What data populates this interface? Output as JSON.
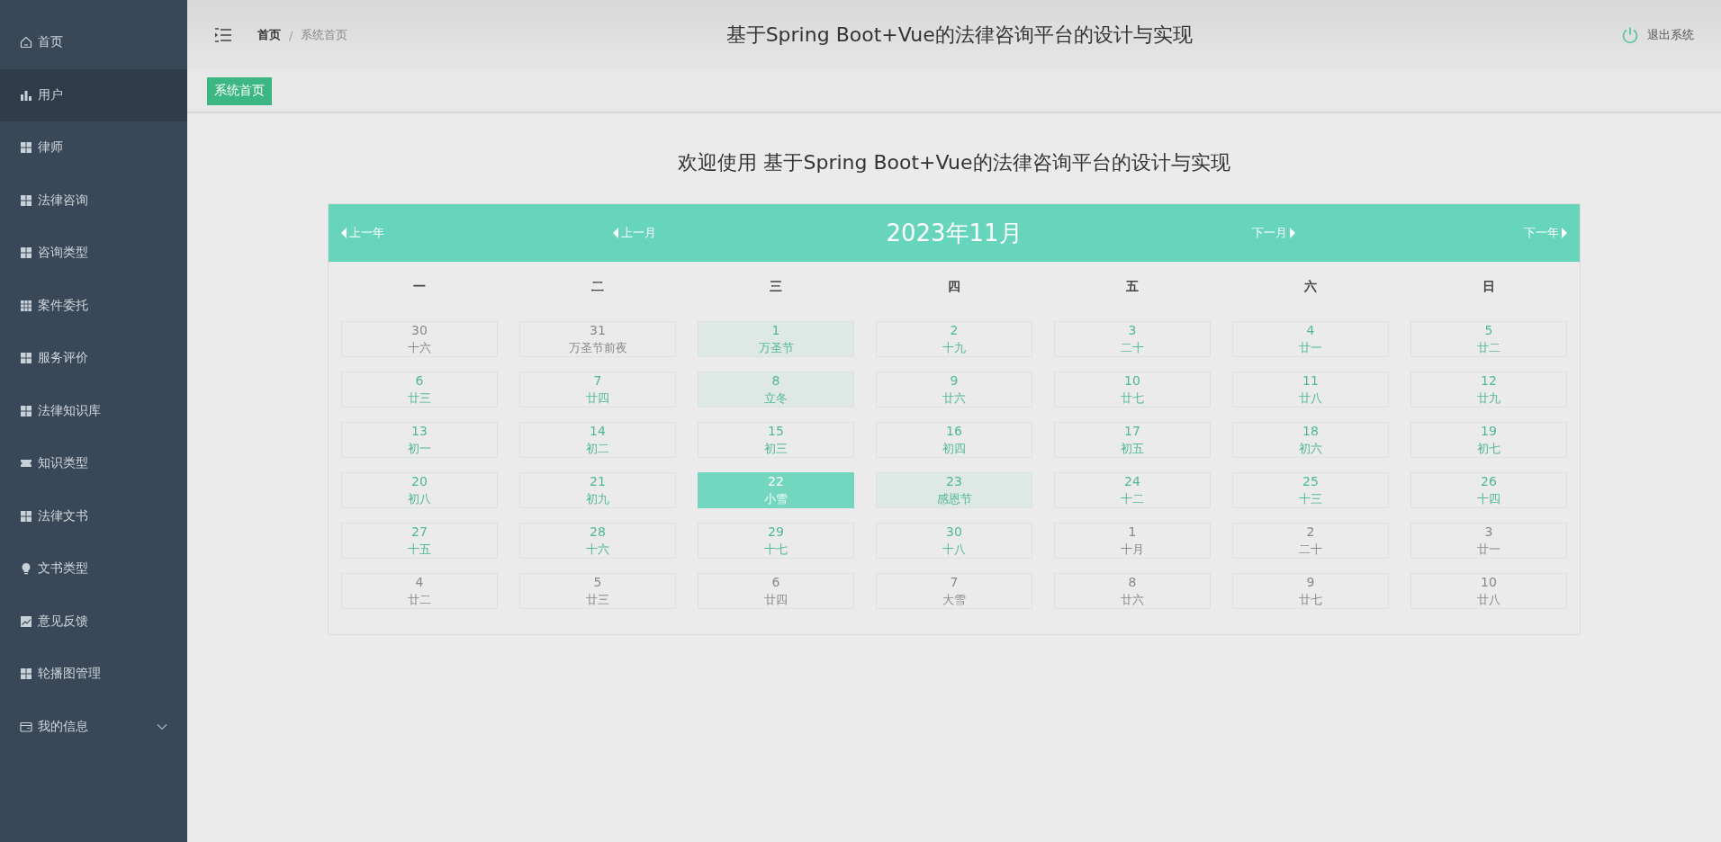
{
  "sidebar": {
    "items": [
      {
        "label": "首页",
        "selected": false
      },
      {
        "label": "用户",
        "selected": true
      },
      {
        "label": "律师",
        "selected": false
      },
      {
        "label": "法律咨询",
        "selected": false
      },
      {
        "label": "咨询类型",
        "selected": false
      },
      {
        "label": "案件委托",
        "selected": false
      },
      {
        "label": "服务评价",
        "selected": false
      },
      {
        "label": "法律知识库",
        "selected": false
      },
      {
        "label": "知识类型",
        "selected": false
      },
      {
        "label": "法律文书",
        "selected": false
      },
      {
        "label": "文书类型",
        "selected": false
      },
      {
        "label": "意见反馈",
        "selected": false
      },
      {
        "label": "轮播图管理",
        "selected": false
      },
      {
        "label": "我的信息",
        "selected": false,
        "expanded": false
      }
    ]
  },
  "header": {
    "breadcrumb": [
      "首页",
      "系统首页"
    ],
    "breadcrumb_separator": "/",
    "title": "基于Spring Boot+Vue的法律咨询平台的设计与实现",
    "logout": "退出系统"
  },
  "tags": [
    {
      "label": "系统首页",
      "selected": true
    }
  ],
  "welcome": "欢迎使用 基于Spring Boot+Vue的法律咨询平台的设计与实现",
  "calendar": {
    "prev_year": "上一年",
    "prev_month": "上一月",
    "month": "2023年11月",
    "next_month": "下一月",
    "next_year": "下一年",
    "weekdays": [
      "一",
      "二",
      "三",
      "四",
      "五",
      "六",
      "日"
    ],
    "days": [
      {
        "day": "30",
        "lunar": "十六",
        "kind": "other"
      },
      {
        "day": "31",
        "lunar": "万圣节前夜",
        "kind": "other"
      },
      {
        "day": "1",
        "lunar": "万圣节",
        "kind": "festival"
      },
      {
        "day": "2",
        "lunar": "十九",
        "kind": "day"
      },
      {
        "day": "3",
        "lunar": "二十",
        "kind": "day"
      },
      {
        "day": "4",
        "lunar": "廿一",
        "kind": "day"
      },
      {
        "day": "5",
        "lunar": "廿二",
        "kind": "day"
      },
      {
        "day": "6",
        "lunar": "廿三",
        "kind": "day"
      },
      {
        "day": "7",
        "lunar": "廿四",
        "kind": "day"
      },
      {
        "day": "8",
        "lunar": "立冬",
        "kind": "festival"
      },
      {
        "day": "9",
        "lunar": "廿六",
        "kind": "day"
      },
      {
        "day": "10",
        "lunar": "廿七",
        "kind": "day"
      },
      {
        "day": "11",
        "lunar": "廿八",
        "kind": "day"
      },
      {
        "day": "12",
        "lunar": "廿九",
        "kind": "day"
      },
      {
        "day": "13",
        "lunar": "初一",
        "kind": "day"
      },
      {
        "day": "14",
        "lunar": "初二",
        "kind": "day"
      },
      {
        "day": "15",
        "lunar": "初三",
        "kind": "day"
      },
      {
        "day": "16",
        "lunar": "初四",
        "kind": "day"
      },
      {
        "day": "17",
        "lunar": "初五",
        "kind": "day"
      },
      {
        "day": "18",
        "lunar": "初六",
        "kind": "day"
      },
      {
        "day": "19",
        "lunar": "初七",
        "kind": "day"
      },
      {
        "day": "20",
        "lunar": "初八",
        "kind": "day"
      },
      {
        "day": "21",
        "lunar": "初九",
        "kind": "day"
      },
      {
        "day": "22",
        "lunar": "小雪",
        "kind": "today"
      },
      {
        "day": "23",
        "lunar": "感恩节",
        "kind": "festival"
      },
      {
        "day": "24",
        "lunar": "十二",
        "kind": "day"
      },
      {
        "day": "25",
        "lunar": "十三",
        "kind": "day"
      },
      {
        "day": "26",
        "lunar": "十四",
        "kind": "day"
      },
      {
        "day": "27",
        "lunar": "十五",
        "kind": "day"
      },
      {
        "day": "28",
        "lunar": "十六",
        "kind": "day"
      },
      {
        "day": "29",
        "lunar": "十七",
        "kind": "day"
      },
      {
        "day": "30",
        "lunar": "十八",
        "kind": "day"
      },
      {
        "day": "1",
        "lunar": "十月",
        "kind": "other"
      },
      {
        "day": "2",
        "lunar": "二十",
        "kind": "other"
      },
      {
        "day": "3",
        "lunar": "廿一",
        "kind": "other"
      },
      {
        "day": "4",
        "lunar": "廿二",
        "kind": "other"
      },
      {
        "day": "5",
        "lunar": "廿三",
        "kind": "other"
      },
      {
        "day": "6",
        "lunar": "廿四",
        "kind": "other"
      },
      {
        "day": "7",
        "lunar": "大雪",
        "kind": "other"
      },
      {
        "day": "8",
        "lunar": "廿六",
        "kind": "other"
      },
      {
        "day": "9",
        "lunar": "廿七",
        "kind": "other"
      },
      {
        "day": "10",
        "lunar": "廿八",
        "kind": "other"
      }
    ]
  }
}
